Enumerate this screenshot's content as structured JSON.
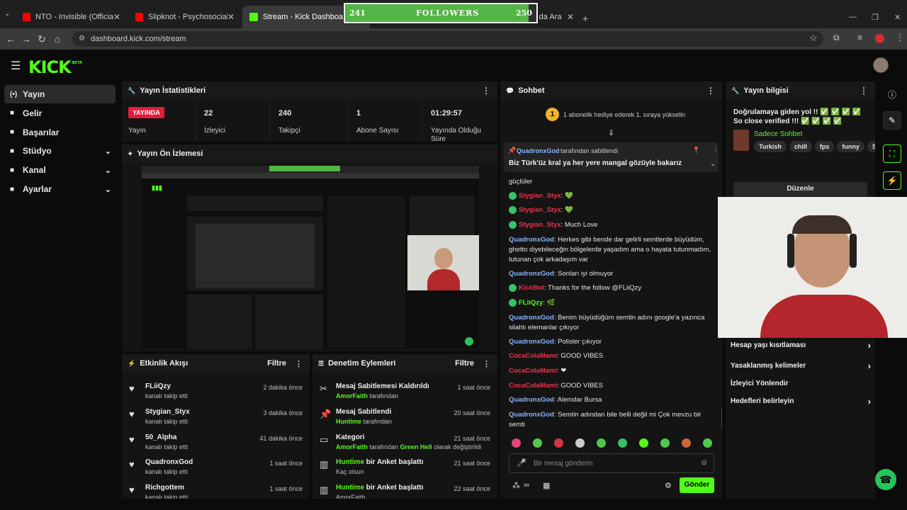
{
  "browser": {
    "tabs": [
      {
        "title": "NTO - Invisible (Official Vid",
        "favicon_color": "#ff0000"
      },
      {
        "title": "Slipknot - Psychosocial [OFFICIA",
        "favicon_color": "#ff0000"
      },
      {
        "title": "Stream - Kick Dashboard",
        "favicon_color": "#53fc18"
      },
      {
        "title": "le'da Ara",
        "favicon_color": "#4285f4"
      }
    ],
    "url": "dashboard.kick.com/stream"
  },
  "overlay": {
    "label": "FOLLOWERS",
    "current": "241",
    "goal": "250",
    "progress": 0.96
  },
  "brand": {
    "logo": "KICK",
    "beta": "BETA"
  },
  "sidebar": [
    {
      "label": "Yayın",
      "icon": "broadcast-icon",
      "active": true
    },
    {
      "label": "Gelir",
      "icon": "revenue-icon"
    },
    {
      "label": "Başarılar",
      "icon": "trophy-icon"
    },
    {
      "label": "Stüdyo",
      "icon": "studio-icon",
      "expand": true
    },
    {
      "label": "Kanal",
      "icon": "channel-icon",
      "expand": true
    },
    {
      "label": "Ayarlar",
      "icon": "gear-icon",
      "expand": true
    }
  ],
  "stats": {
    "title": "Yayın İstatistikleri",
    "live_badge": "YAYINDA",
    "live_label": "Yayın",
    "items": [
      {
        "value": "22",
        "label": "İzleyici"
      },
      {
        "value": "240",
        "label": "Takipçi"
      },
      {
        "value": "1",
        "label": "Abone Sayısı"
      },
      {
        "value": "01:29:57",
        "label": "Yayında Olduğu Süre"
      }
    ]
  },
  "preview": {
    "title": "Yayın Ön İzlemesi"
  },
  "activity": {
    "title": "Etkinlik Akışı",
    "filter": "Filtre",
    "items": [
      {
        "name": "FLiiQzy",
        "sub": "kanalı takip etti",
        "time": "2 dakika önce"
      },
      {
        "name": "Stygian_Styx",
        "sub": "kanalı takip etti",
        "time": "3 dakika önce"
      },
      {
        "name": "50_Alpha",
        "sub": "kanalı takip etti",
        "time": "41 dakika önce"
      },
      {
        "name": "QuadronxGod",
        "sub": "kanalı takip etti",
        "time": "1 saat önce"
      },
      {
        "name": "Richgottem",
        "sub": "kanalı takip etti",
        "time": "1 saat önce"
      }
    ]
  },
  "moderation": {
    "title": "Denetim Eylemleri",
    "filter": "Filtre",
    "items": [
      {
        "title": "Mesaj Sabitlemesi Kaldırıldı",
        "user": "AmorFaith",
        "rest": " tarafından",
        "time": "1 saat önce",
        "icon": "unpin-icon"
      },
      {
        "title": "Mesaj Sabitlendi",
        "user": "Huntime",
        "rest": " tarafından",
        "time": "20 saat önce",
        "icon": "pin-icon"
      },
      {
        "title": "Kategori",
        "user": "AmorFaith",
        "rest": " tarafından ",
        "user2": "Green Hell",
        "rest2": " olarak değiştirildi",
        "time": "21 saat önce",
        "icon": "category-icon"
      },
      {
        "title": " bir Anket başlattı",
        "titleuser": "Huntime",
        "rest": "Kaç olsun",
        "time": "21 saat önce",
        "icon": "poll-icon"
      },
      {
        "title": " bir Anket başlattı",
        "titleuser": "Huntime",
        "rest": "AmorFaith",
        "time": "22 saat önce",
        "icon": "poll-icon"
      }
    ]
  },
  "chat": {
    "title": "Sohbet",
    "gift_banner": "1 abonelik hediye ederek 1. sıraya yükselin",
    "gift_rank": "1",
    "pinned_by": "QuadronxGod",
    "pinned_by_suffix": " tarafından sabitlendi",
    "pinned_text": "Biz Türk'üz kral ya her yere mangal gözüyle bakarız",
    "messages": [
      {
        "user": "",
        "text": "güçlüler"
      },
      {
        "user": "Stygian_Styx",
        "color": "red",
        "text": ": 💚",
        "badge": true
      },
      {
        "user": "Stygian_Styx",
        "color": "red",
        "text": ": 💚",
        "badge": true
      },
      {
        "user": "Stygian_Styx",
        "color": "red",
        "text": ": Much Love",
        "badge": true
      },
      {
        "user": "QuadronxGod",
        "color": "blue",
        "text": ": Herkes gibi bende dar gelirli semtlerde büyüdüm, ghetto diyebileceğin bölgelerde yaşadım ama o hayata tutunmadım, tutunan çok arkadaşım var"
      },
      {
        "user": "QuadronxGod",
        "color": "blue",
        "text": ": Sonları iyi olmuyor"
      },
      {
        "user": "KickBot",
        "color": "red",
        "text": ": Thanks for the follow @FLiiQzy",
        "badge": true
      },
      {
        "user": "FLiiQzy",
        "color": "green",
        "text": ": 🌿",
        "badge": true
      },
      {
        "user": "QuadronxGod",
        "color": "blue",
        "text": ": Benim büyüdüğüm semtin adını google'a yazınca silahlı elemanlar çıkıyor"
      },
      {
        "user": "QuadronxGod",
        "color": "blue",
        "text": ": Polisler çıkıyor"
      },
      {
        "user": "CocaColaMami",
        "color": "red",
        "text": ": GOOD VIBES"
      },
      {
        "user": "CocaColaMami",
        "color": "red",
        "text": ": ❤"
      },
      {
        "user": "CocaColaMami",
        "color": "red",
        "text": ": GOOD VIBES"
      },
      {
        "user": "QuadronxGod",
        "color": "blue",
        "text": ": Alemdar Bursa"
      },
      {
        "user": "QuadronxGod",
        "color": "blue",
        "text": ": Semtin adından bile belli değil mi  Çok mevzu bir semti"
      }
    ],
    "input_placeholder": "Bir mesaj gönderin",
    "send": "Gönder"
  },
  "info": {
    "title": "Yayın bilgisi",
    "stream_title": "Doğrulamaya giden yol !! ✅ ✅ ✅ ✅ So close verified !!! ✅ ✅ ✅ ✅",
    "category": "Sadece Sohbet",
    "tags": [
      "Turkish",
      "chill",
      "fps",
      "funny",
      "Sho"
    ],
    "edit": "Düzenle",
    "items": [
      {
        "label": "Hesap yaşı kısıtlaması",
        "chevron": true
      },
      {
        "label": "Yasaklanmış kelimeler",
        "chevron": true
      },
      {
        "label": "İzleyici Yönlendir",
        "chevron": false
      },
      {
        "label": "Hedefleri belirleyin",
        "chevron": true
      }
    ]
  }
}
